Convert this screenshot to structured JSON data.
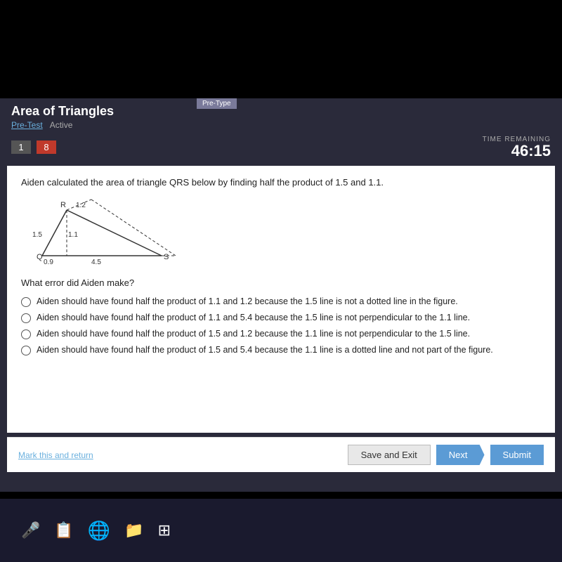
{
  "app": {
    "title": "Area of Triangles",
    "pre_type_badge": "Pre-Type",
    "breadcrumb": {
      "pretest": "Pre-Test",
      "active": "Active"
    },
    "nav": {
      "page_current": "1",
      "page_badge": "8"
    },
    "time": {
      "label": "TIME REMAINING",
      "value": "46:15"
    }
  },
  "question": {
    "text": "Aiden calculated the area of triangle QRS below by finding half the product of 1.5 and 1.1.",
    "prompt": "What error did Aiden make?",
    "options": [
      "Aiden should have found half the product of 1.1 and 1.2 because the 1.5 line is not a dotted line in the figure.",
      "Aiden should have found half the product of 1.1 and 5.4 because the 1.5 line is not perpendicular to the 1.1 line.",
      "Aiden should have found half the product of 1.5 and 1.2 because the 1.1 line is not perpendicular to the 1.5 line.",
      "Aiden should have found half the product of 1.5 and 5.4 because the 1.1 line is a dotted line and not part of the figure."
    ]
  },
  "footer": {
    "mark_return": "Mark this and return",
    "save_exit": "Save and Exit",
    "next": "Next",
    "submit": "Submit"
  },
  "taskbar": {
    "icons": [
      "microphone",
      "file-explorer",
      "edge-browser",
      "folder",
      "apps"
    ]
  }
}
